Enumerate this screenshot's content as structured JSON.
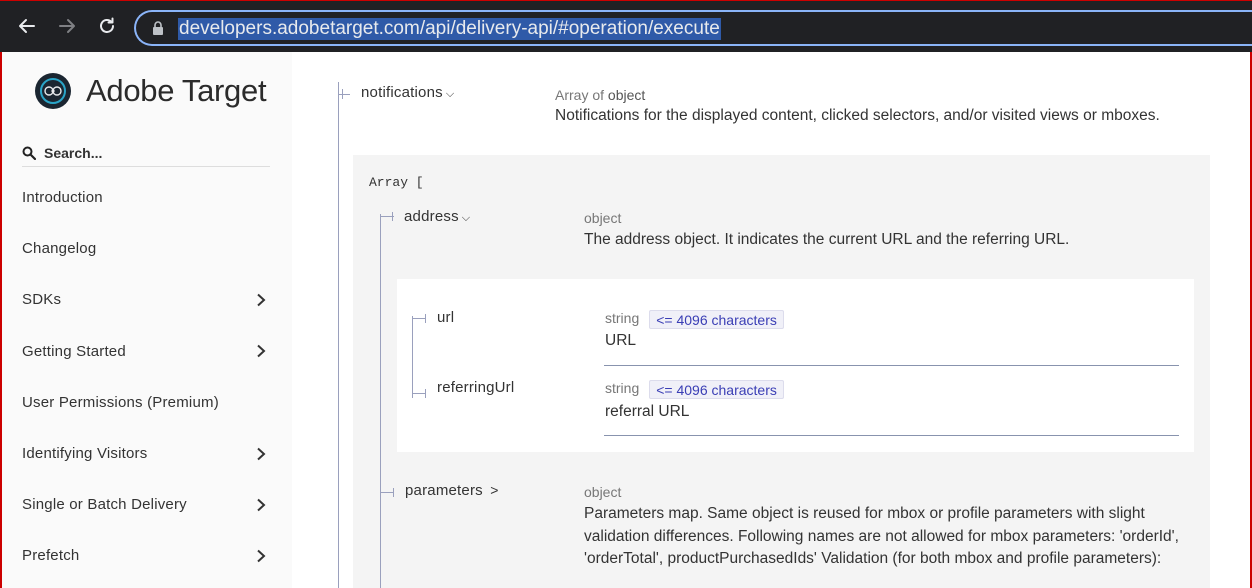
{
  "browser": {
    "url": "developers.adobetarget.com/api/delivery-api/#operation/execute",
    "icons": [
      "back-arrow-icon",
      "forward-arrow-icon",
      "reload-icon",
      "lock-icon"
    ]
  },
  "sidebar": {
    "logo_text": "Adobe Target",
    "search_placeholder": "Search...",
    "items": [
      {
        "label": "Introduction",
        "has_chevron": false
      },
      {
        "label": "Changelog",
        "has_chevron": false
      },
      {
        "label": "SDKs",
        "has_chevron": true
      },
      {
        "label": "Getting Started",
        "has_chevron": true
      },
      {
        "label": "User Permissions (Premium)",
        "has_chevron": false
      },
      {
        "label": "Identifying Visitors",
        "has_chevron": true
      },
      {
        "label": "Single or Batch Delivery",
        "has_chevron": true
      },
      {
        "label": "Prefetch",
        "has_chevron": true
      }
    ]
  },
  "schema": {
    "notifications": {
      "name": "notifications",
      "caret": "⌵",
      "type_prefix": "Array of",
      "type": "object",
      "description": "Notifications for the displayed content, clicked selectors, and/or visited views or mboxes."
    },
    "array_label": "Array [",
    "address": {
      "name": "address",
      "caret": "⌵",
      "type": "object",
      "description": "The address object. It indicates the current URL and the referring URL."
    },
    "url": {
      "name": "url",
      "type": "string",
      "constraint": "<= 4096 characters",
      "description": "URL"
    },
    "referringUrl": {
      "name": "referringUrl",
      "type": "string",
      "constraint": "<= 4096 characters",
      "description": "referral URL"
    },
    "parameters": {
      "name": "parameters",
      "caret": ">",
      "type": "object",
      "description": "Parameters map. Same object is reused for mbox or profile parameters with slight validation differences. Following names are not allowed for mbox parameters: 'orderId', 'orderTotal', productPurchasedIds' Validation (for both mbox and profile parameters):"
    }
  },
  "colors": {
    "chrome_bg": "#202124",
    "omnibox_border": "#8ab4f8",
    "url_highlight": "#2f5aa8",
    "badge_text": "#3a3eb5",
    "frame_border": "#cc0000"
  }
}
